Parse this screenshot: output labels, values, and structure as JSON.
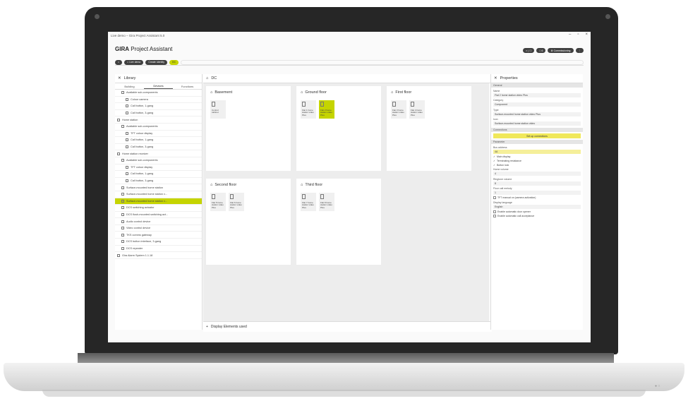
{
  "window": {
    "title": "Live demo – Gira Project Assistant 5.0",
    "buttons": [
      "–",
      "▫",
      "×"
    ]
  },
  "app": {
    "brand": "GIRA",
    "name": "Project Assistant"
  },
  "toolbar": {
    "buttons": [
      "◐ | ☐",
      "□ 6",
      "⚙ Commissioning",
      "⋮"
    ]
  },
  "breadcrumb": {
    "home": "⌂",
    "items": [
      "⌂ Live demo",
      "Create identity"
    ],
    "active": "DC"
  },
  "library": {
    "header": "Library",
    "tabs": [
      "Building",
      "Devices",
      "Functions"
    ],
    "items": [
      {
        "label": "Available sub-components",
        "icon": "arrow-down-icon",
        "indent": 1,
        "selected": false
      },
      {
        "label": "Colour camera",
        "icon": "camera-icon",
        "indent": 2,
        "selected": false
      },
      {
        "label": "Call button, 1-gang",
        "icon": "device-icon",
        "indent": 2,
        "selected": false
      },
      {
        "label": "Call button, 3-gang",
        "icon": "device-icon",
        "indent": 2,
        "selected": false
      },
      {
        "label": "Home station",
        "icon": "device-icon",
        "indent": 0,
        "selected": false
      },
      {
        "label": "Available sub-components",
        "icon": "arrow-down-icon",
        "indent": 1,
        "selected": false
      },
      {
        "label": "TFT colour display",
        "icon": "display-icon",
        "indent": 2,
        "selected": false
      },
      {
        "label": "Call button, 1-gang",
        "icon": "device-icon",
        "indent": 2,
        "selected": false
      },
      {
        "label": "Call button, 3-gang",
        "icon": "device-icon",
        "indent": 2,
        "selected": false
      },
      {
        "label": "Home station receiver",
        "icon": "device-icon",
        "indent": 0,
        "selected": false
      },
      {
        "label": "Available sub-components",
        "icon": "arrow-down-icon",
        "indent": 1,
        "selected": false
      },
      {
        "label": "TFT colour display",
        "icon": "display-icon",
        "indent": 2,
        "selected": false
      },
      {
        "label": "Call button, 1-gang",
        "icon": "device-icon",
        "indent": 2,
        "selected": false
      },
      {
        "label": "Call button, 3-gang",
        "icon": "device-icon",
        "indent": 2,
        "selected": false
      },
      {
        "label": "Surface-mounted home station",
        "icon": "device-icon",
        "indent": 1,
        "selected": false
      },
      {
        "label": "Surface-mounted home station v...",
        "icon": "device-icon",
        "indent": 1,
        "selected": false
      },
      {
        "label": "Surface-mounted home station v...",
        "icon": "device-icon",
        "indent": 1,
        "selected": true
      },
      {
        "label": "DCS switching actuator",
        "icon": "device-icon",
        "indent": 1,
        "selected": false
      },
      {
        "label": "DCS flush-mounted switching act...",
        "icon": "device-icon",
        "indent": 1,
        "selected": false
      },
      {
        "label": "Audio control device",
        "icon": "device-icon",
        "indent": 1,
        "selected": false
      },
      {
        "label": "Video control device",
        "icon": "device-icon",
        "indent": 1,
        "selected": false
      },
      {
        "label": "TKS comms gateway",
        "icon": "device-icon",
        "indent": 1,
        "selected": false
      },
      {
        "label": "DCS button interface, 3-gang",
        "icon": "device-icon",
        "indent": 1,
        "selected": false
      },
      {
        "label": "DCS repeater",
        "icon": "device-icon",
        "indent": 1,
        "selected": false
      },
      {
        "label": "Gira Alarm System 1.1.18",
        "icon": "device-icon",
        "indent": 0,
        "selected": false
      }
    ]
  },
  "main": {
    "header": "DC",
    "floors": [
      {
        "name": "Basement",
        "devices": [
          {
            "label": "Control cabinet",
            "selected": false
          }
        ]
      },
      {
        "name": "Ground floor",
        "devices": [
          {
            "label": "Flat 1 home station video Plus",
            "selected": false
          },
          {
            "label": "Flat 2 home station video Plus",
            "selected": true
          }
        ]
      },
      {
        "name": "First floor",
        "devices": [
          {
            "label": "Flat 3 home station video Plus",
            "selected": false
          },
          {
            "label": "Flat 4 home station video Plus",
            "selected": false
          }
        ]
      },
      {
        "name": "Second floor",
        "devices": [
          {
            "label": "Flat 5 home station video Plus",
            "selected": false
          },
          {
            "label": "Flat 6 home station video Plus",
            "selected": false
          }
        ]
      },
      {
        "name": "Third floor",
        "devices": [
          {
            "label": "Flat 7 home station video Plus",
            "selected": false
          },
          {
            "label": "Flat 8 home station video Plus",
            "selected": false
          }
        ]
      }
    ],
    "footer": "Display Elements used"
  },
  "properties": {
    "header": "Properties",
    "sections": {
      "general": "General",
      "connections": "Connections",
      "parameter": "Parameter"
    },
    "name_label": "Name",
    "name_value": "Flat 2 home station video Plus",
    "category_label": "Category",
    "category_value": "Component",
    "type_label": "Type",
    "type_value": "Surface-mounted home station video Plus",
    "icon_label": "Icon",
    "icon_value": "Surface-mounted home station video",
    "connections_button": "Set up connections",
    "bus_address_label": "Bus address",
    "bus_address_value": "4A",
    "checks": [
      {
        "label": "Main display",
        "checked": true
      },
      {
        "label": "Terminating resistance",
        "checked": true
      },
      {
        "label": "Button lock",
        "checked": true
      }
    ],
    "home_volume_label": "Home volume",
    "home_volume_value": "4",
    "ringtone_volume_label": "Ringtone volume",
    "ringtone_volume_value": "8",
    "floor_call_label": "Floor call melody",
    "floor_call_value": "1",
    "manual_check": "TFT manual on (camera activation)",
    "language_label": "Display language",
    "language_value": "English",
    "tail_checks": [
      "Enable automatic door opener",
      "Enable automatic call acceptance"
    ]
  }
}
